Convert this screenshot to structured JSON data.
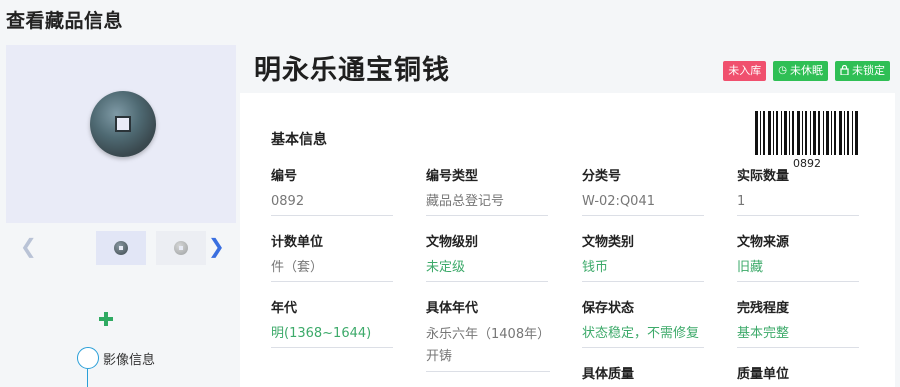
{
  "page": {
    "title": "查看藏品信息"
  },
  "relic": {
    "name": "明永乐通宝铜钱"
  },
  "badges": [
    {
      "label": "未入库",
      "color": "#f0506e"
    },
    {
      "label": "未休眠",
      "icon": "clock-icon",
      "color": "#2fbf55"
    },
    {
      "label": "未锁定",
      "icon": "lock-icon",
      "color": "#2fbf55"
    }
  ],
  "gallery": {
    "prev_icon": "chevron-left-icon",
    "next_icon": "chevron-right-icon",
    "thumbnails": 2
  },
  "sidebar": {
    "add_icon": "plus-icon",
    "timeline": [
      {
        "label": "影像信息"
      }
    ]
  },
  "basic_info": {
    "title": "基本信息",
    "barcode_number": "0892",
    "fields": [
      {
        "label": "编号",
        "value": "0892"
      },
      {
        "label": "编号类型",
        "value": "藏品总登记号"
      },
      {
        "label": "分类号",
        "value": "W-02:Q041"
      },
      {
        "label": "实际数量",
        "value": "1"
      },
      {
        "label": "计数单位",
        "value": "件（套）"
      },
      {
        "label": "文物级别",
        "value": "未定级"
      },
      {
        "label": "文物类别",
        "value": "钱币"
      },
      {
        "label": "文物来源",
        "value": "旧藏"
      },
      {
        "label": "年代",
        "value": "明(1368~1644)"
      },
      {
        "label": "具体年代",
        "value": "永乐六年（1408年）开铸"
      },
      {
        "label": "保存状态",
        "value": "状态稳定，不需修复"
      },
      {
        "label": "完残程度",
        "value": "基本完整"
      },
      {
        "label": "具体质量",
        "value": ""
      },
      {
        "label": "质量单位",
        "value": ""
      }
    ]
  },
  "colors": {
    "accent_green": "#3daa6a",
    "badge_red": "#f0506e",
    "badge_green": "#2fbf55",
    "link_blue": "#3a6fe0"
  }
}
